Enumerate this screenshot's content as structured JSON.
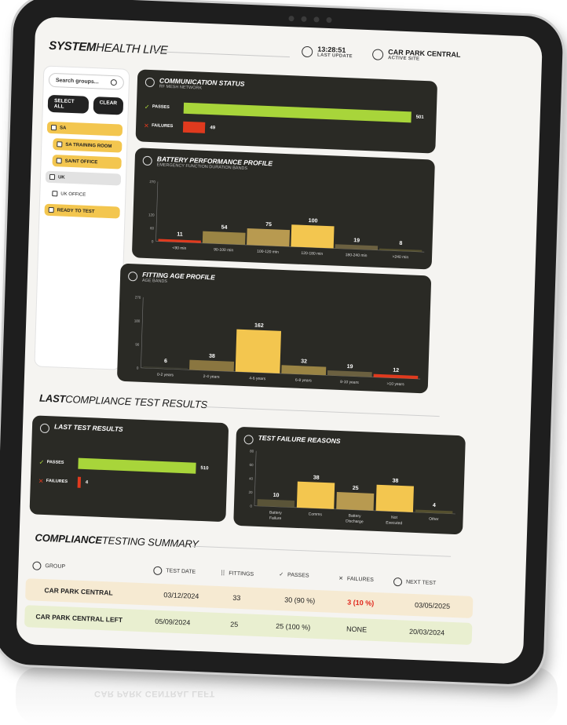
{
  "header": {
    "brand_bold": "SYSTEM",
    "brand_light": "HEALTH LIVE",
    "time": "13:28:51",
    "time_label": "LAST UPDATE",
    "site": "CAR PARK CENTRAL",
    "site_label": "ACTIVE SITE"
  },
  "sidebar": {
    "search_placeholder": "Search groups...",
    "select_all": "SELECT ALL",
    "clear": "CLEAR",
    "items": [
      {
        "label": "SA"
      },
      {
        "label": "SA TRAINING ROOM"
      },
      {
        "label": "SA/NT OFFICE"
      },
      {
        "label": "UK"
      },
      {
        "label": "UK OFFICE"
      },
      {
        "label": "READY TO TEST"
      }
    ]
  },
  "comm": {
    "title": "COMMUNICATION STATUS",
    "subtitle": "RF MESH NETWORK",
    "passes_label": "PASSES",
    "failures_label": "FAILURES",
    "passes": "501",
    "failures": "49"
  },
  "battery": {
    "title": "BATTERY PERFORMANCE PROFILE",
    "subtitle": "EMERGENCY FUNCTION DURATION BANDS"
  },
  "age": {
    "title": "FITTING AGE PROFILE",
    "subtitle": "AGE BANDS"
  },
  "last_section": {
    "bold": "LAST",
    "light": "COMPLIANCE TEST RESULTS"
  },
  "last_results": {
    "title": "LAST TEST RESULTS",
    "passes_label": "PASSES",
    "failures_label": "FAILURES",
    "passes": "510",
    "failures": "4"
  },
  "failure_reasons": {
    "title": "TEST FAILURE REASONS"
  },
  "summary_section": {
    "bold": "COMPLIANCE",
    "light": "TESTING SUMMARY"
  },
  "table": {
    "headers": {
      "group": "GROUP",
      "test_date": "TEST DATE",
      "fittings": "FITTINGS",
      "passes": "PASSES",
      "failures": "FAILURES",
      "next_test": "NEXT TEST"
    },
    "rows": [
      {
        "group": "CAR PARK CENTRAL",
        "test_date": "03/12/2024",
        "fittings": "33",
        "passes": "30 (90 %)",
        "failures": "3 (10 %)",
        "next_test": "03/05/2025"
      },
      {
        "group": "CAR PARK CENTRAL LEFT",
        "test_date": "05/09/2024",
        "fittings": "25",
        "passes": "25 (100 %)",
        "failures": "NONE",
        "next_test": "20/03/2024"
      }
    ]
  },
  "reflection_text": "CAR PARK CENTRAL LEFT",
  "colors": {
    "accent_green": "#a8d53a",
    "accent_red": "#e03a1e",
    "gold": "#f3c64f",
    "card_bg": "#2a2a25"
  },
  "chart_data": [
    {
      "type": "bar",
      "categories": [
        "PASSES",
        "FAILURES"
      ],
      "values": [
        501,
        49
      ],
      "orientation": "horizontal"
    },
    {
      "type": "bar",
      "title": "BATTERY PERFORMANCE PROFILE",
      "subtitle": "EMERGENCY FUNCTION DURATION BANDS",
      "categories": [
        "<90 min",
        "90-100 min",
        "100-120 min",
        "120-180 min",
        "180-240 min",
        ">240 min"
      ],
      "values": [
        11,
        54,
        75,
        100,
        19,
        8
      ],
      "yticks": [
        0,
        60,
        120,
        270
      ],
      "ylim": [
        0,
        270
      ],
      "bar_colors": [
        "#e03a1e",
        "#9a8444",
        "#b89a50",
        "#f3c64f",
        "#6b6040",
        "#55502f"
      ]
    },
    {
      "type": "bar",
      "title": "FITTING AGE PROFILE",
      "subtitle": "AGE BANDS",
      "categories": [
        "0-2 years",
        "2-4 years",
        "4-6 years",
        "6-8 years",
        "8-10 years",
        ">10 years"
      ],
      "values": [
        6,
        38,
        162,
        32,
        19,
        12
      ],
      "yticks": [
        0,
        90,
        180,
        270
      ],
      "ylim": [
        0,
        270
      ],
      "bar_colors": [
        "#3a3a30",
        "#8a7640",
        "#f3c64f",
        "#9a8444",
        "#6b6040",
        "#e03a1e"
      ]
    },
    {
      "type": "bar",
      "categories": [
        "PASSES",
        "FAILURES"
      ],
      "values": [
        510,
        4
      ],
      "orientation": "horizontal"
    },
    {
      "type": "bar",
      "title": "TEST FAILURE REASONS",
      "categories": [
        "Battery Failure",
        "Comms",
        "Battery Discharge",
        "Not Executed",
        "Other"
      ],
      "values": [
        10,
        38,
        25,
        38,
        4
      ],
      "yticks": [
        0,
        20,
        40,
        60,
        80
      ],
      "ylim": [
        0,
        80
      ],
      "bar_colors": [
        "#5a5438",
        "#f3c64f",
        "#b89a50",
        "#f3c64f",
        "#55502f"
      ]
    }
  ]
}
